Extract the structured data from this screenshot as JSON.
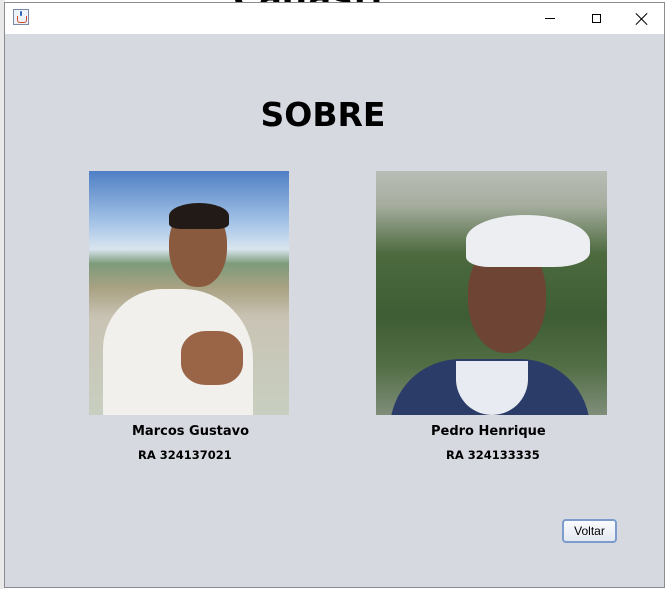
{
  "background": {
    "partial_text": "Cadastr"
  },
  "window": {
    "title": "",
    "icon": "java-coffee-icon",
    "controls": {
      "minimize": "minimize-icon",
      "maximize": "maximize-icon",
      "close": "close-icon"
    }
  },
  "page": {
    "title": "SOBRE"
  },
  "people": [
    {
      "name": "Marcos Gustavo",
      "ra": "RA 324137021"
    },
    {
      "name": "Pedro Henrique",
      "ra": "RA 324133335"
    }
  ],
  "actions": {
    "back_label": "Voltar"
  },
  "colors": {
    "panel_bg": "#d6d9e0",
    "button_border": "#7b9ccc"
  }
}
